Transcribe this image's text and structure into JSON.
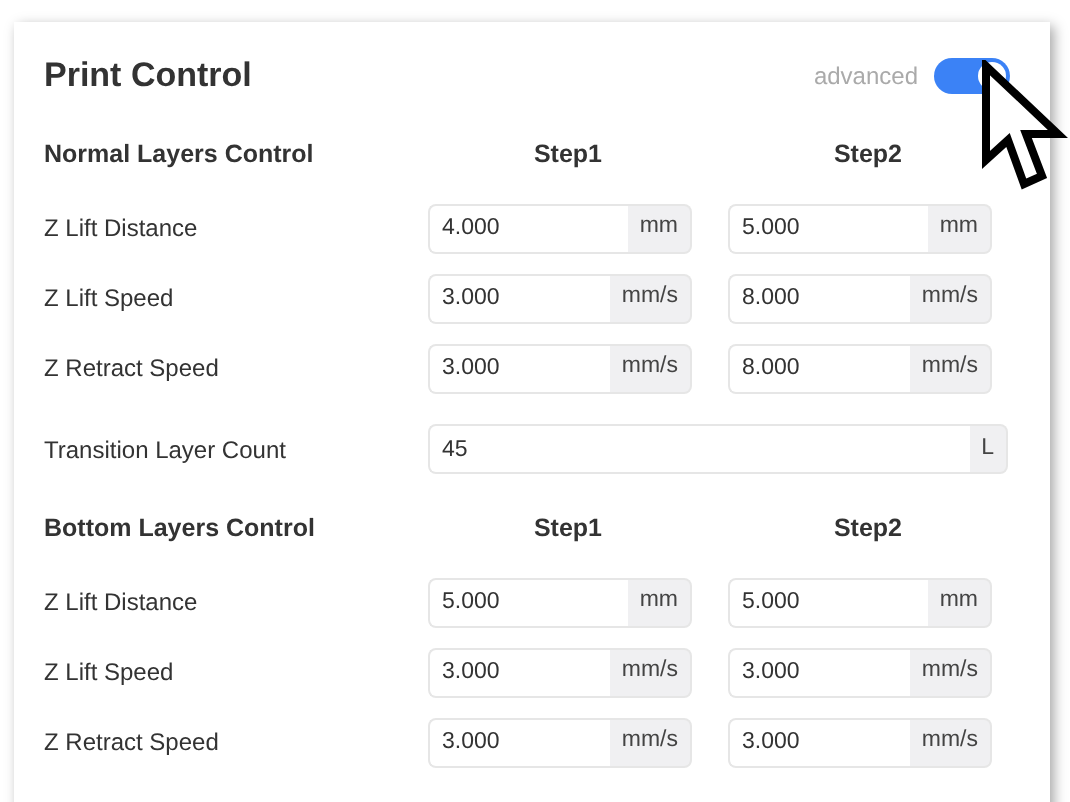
{
  "title": "Print Control",
  "advanced": {
    "label": "advanced",
    "on": true
  },
  "groups": [
    {
      "kind": "steps",
      "title": "Normal Layers Control",
      "columns": [
        "Step1",
        "Step2"
      ],
      "rows": [
        {
          "label": "Z Lift Distance",
          "fields": [
            {
              "value": "4.000",
              "unit": "mm"
            },
            {
              "value": "5.000",
              "unit": "mm"
            }
          ]
        },
        {
          "label": "Z Lift Speed",
          "fields": [
            {
              "value": "3.000",
              "unit": "mm/s"
            },
            {
              "value": "8.000",
              "unit": "mm/s"
            }
          ]
        },
        {
          "label": "Z Retract Speed",
          "fields": [
            {
              "value": "3.000",
              "unit": "mm/s"
            },
            {
              "value": "8.000",
              "unit": "mm/s"
            }
          ]
        }
      ]
    },
    {
      "kind": "single",
      "label": "Transition Layer Count",
      "field": {
        "value": "45",
        "unit": "L"
      }
    },
    {
      "kind": "steps",
      "title": "Bottom Layers Control",
      "columns": [
        "Step1",
        "Step2"
      ],
      "rows": [
        {
          "label": "Z Lift Distance",
          "fields": [
            {
              "value": "5.000",
              "unit": "mm"
            },
            {
              "value": "5.000",
              "unit": "mm"
            }
          ]
        },
        {
          "label": "Z Lift Speed",
          "fields": [
            {
              "value": "3.000",
              "unit": "mm/s"
            },
            {
              "value": "3.000",
              "unit": "mm/s"
            }
          ]
        },
        {
          "label": "Z Retract Speed",
          "fields": [
            {
              "value": "3.000",
              "unit": "mm/s"
            },
            {
              "value": "3.000",
              "unit": "mm/s"
            }
          ]
        }
      ]
    }
  ]
}
